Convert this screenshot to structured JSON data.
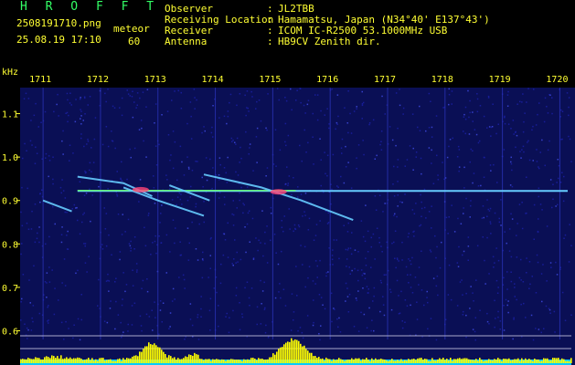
{
  "header": {
    "brand": "H R O F F T",
    "filename": "2508191710.png",
    "datetime": "25.08.19 17:10",
    "mode_label": "meteor",
    "count": "60",
    "info": [
      {
        "label": "Observer",
        "value": "JL2TBB"
      },
      {
        "label": "Receiving Location",
        "value": "Hamamatsu, Japan (N34°40' E137°43')"
      },
      {
        "label": "Receiver",
        "value": "ICOM IC-R2500 53.1000MHz USB"
      },
      {
        "label": "Antenna",
        "value": "HB9CV Zenith dir."
      }
    ],
    "colon": ":"
  },
  "colors": {
    "yellow": "#ffff33",
    "green": "#33ff66",
    "background": "#000000",
    "noise": "#1a1f9e",
    "carrier": "#66ff66",
    "trail": "#66ccff",
    "hot": "#ff4477",
    "bars": "#ffff00",
    "base": "#00ccff"
  },
  "chart_data": {
    "type": "heatmap",
    "ylabel": "kHz",
    "x_ticks": [
      "1711",
      "1712",
      "1713",
      "1714",
      "1715",
      "1716",
      "1717",
      "1718",
      "1719",
      "1720"
    ],
    "y_ticks": [
      "1.1",
      "1.0",
      "0.9",
      "0.8",
      "0.7",
      "0.6"
    ],
    "ylim": [
      0.58,
      1.16
    ],
    "xlim": [
      1710.6,
      1720.2
    ],
    "carrier_khz": 0.922,
    "trails": [
      {
        "x": [
          1711.6,
          1712.4,
          1712.9
        ],
        "y": [
          0.955,
          0.94,
          0.91
        ]
      },
      {
        "x": [
          1712.4,
          1713.0,
          1713.8
        ],
        "y": [
          0.93,
          0.9,
          0.865
        ]
      },
      {
        "x": [
          1711.0,
          1711.5
        ],
        "y": [
          0.9,
          0.875
        ]
      },
      {
        "x": [
          1713.2,
          1713.9
        ],
        "y": [
          0.935,
          0.9
        ]
      },
      {
        "x": [
          1713.8,
          1714.8,
          1715.5,
          1716.4
        ],
        "y": [
          0.96,
          0.93,
          0.9,
          0.855
        ]
      }
    ]
  }
}
